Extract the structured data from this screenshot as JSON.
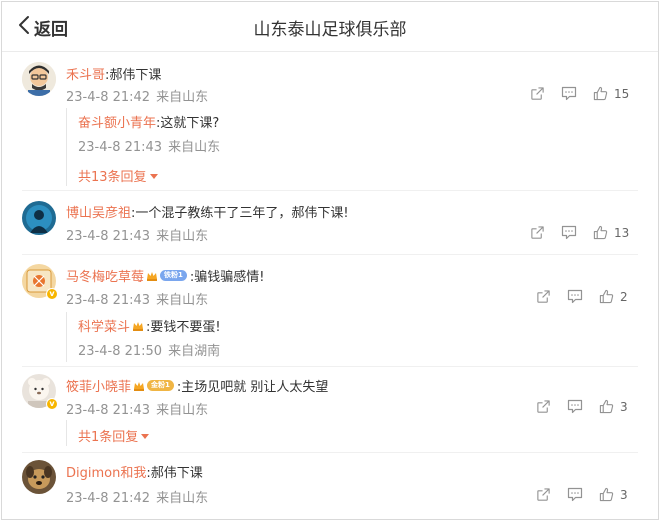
{
  "header": {
    "back_label": "返回",
    "title": "山东泰山足球俱乐部"
  },
  "comments": [
    {
      "user": "禾斗哥",
      "text": ":郝伟下课",
      "time": "23-4-8 21:42",
      "source": "来自山东",
      "likes": "15",
      "reply": {
        "user": "奋斗额小青年",
        "text": ":这就下课?",
        "time": "23-4-8 21:43",
        "source": "来自山东"
      },
      "more_label": "共13条回复"
    },
    {
      "user": "博山吴彦祖",
      "text": ":一个混子教练干了三年了，郝伟下课!",
      "time": "23-4-8 21:43",
      "source": "来自山东",
      "likes": "13"
    },
    {
      "user": "马冬梅吃草莓",
      "fan_level": "铁粉1",
      "text": ":骗钱骗感情!",
      "time": "23-4-8 21:43",
      "source": "来自山东",
      "likes": "2",
      "reply": {
        "user": "科学菜斗",
        "text": ":要钱不要蛋!",
        "time": "23-4-8 21:50",
        "source": "来自湖南"
      }
    },
    {
      "user": "筱菲小晓菲",
      "fan_level": "金粉1",
      "text": ":主场见吧就  别让人太失望",
      "time": "23-4-8 21:43",
      "source": "来自山东",
      "likes": "3",
      "more_label": "共1条回复"
    },
    {
      "user": "Digimon和我",
      "text": ":郝伟下课",
      "time": "23-4-8 21:42",
      "source": "来自山东",
      "likes": "3"
    }
  ],
  "icons": {
    "back": "chevron-left-icon",
    "share": "share-icon",
    "comment": "comment-icon",
    "like": "thumbs-up-icon",
    "fan": "crown-icon"
  },
  "colors": {
    "username": "#eb7350",
    "meta": "#939393",
    "text": "#333333"
  }
}
